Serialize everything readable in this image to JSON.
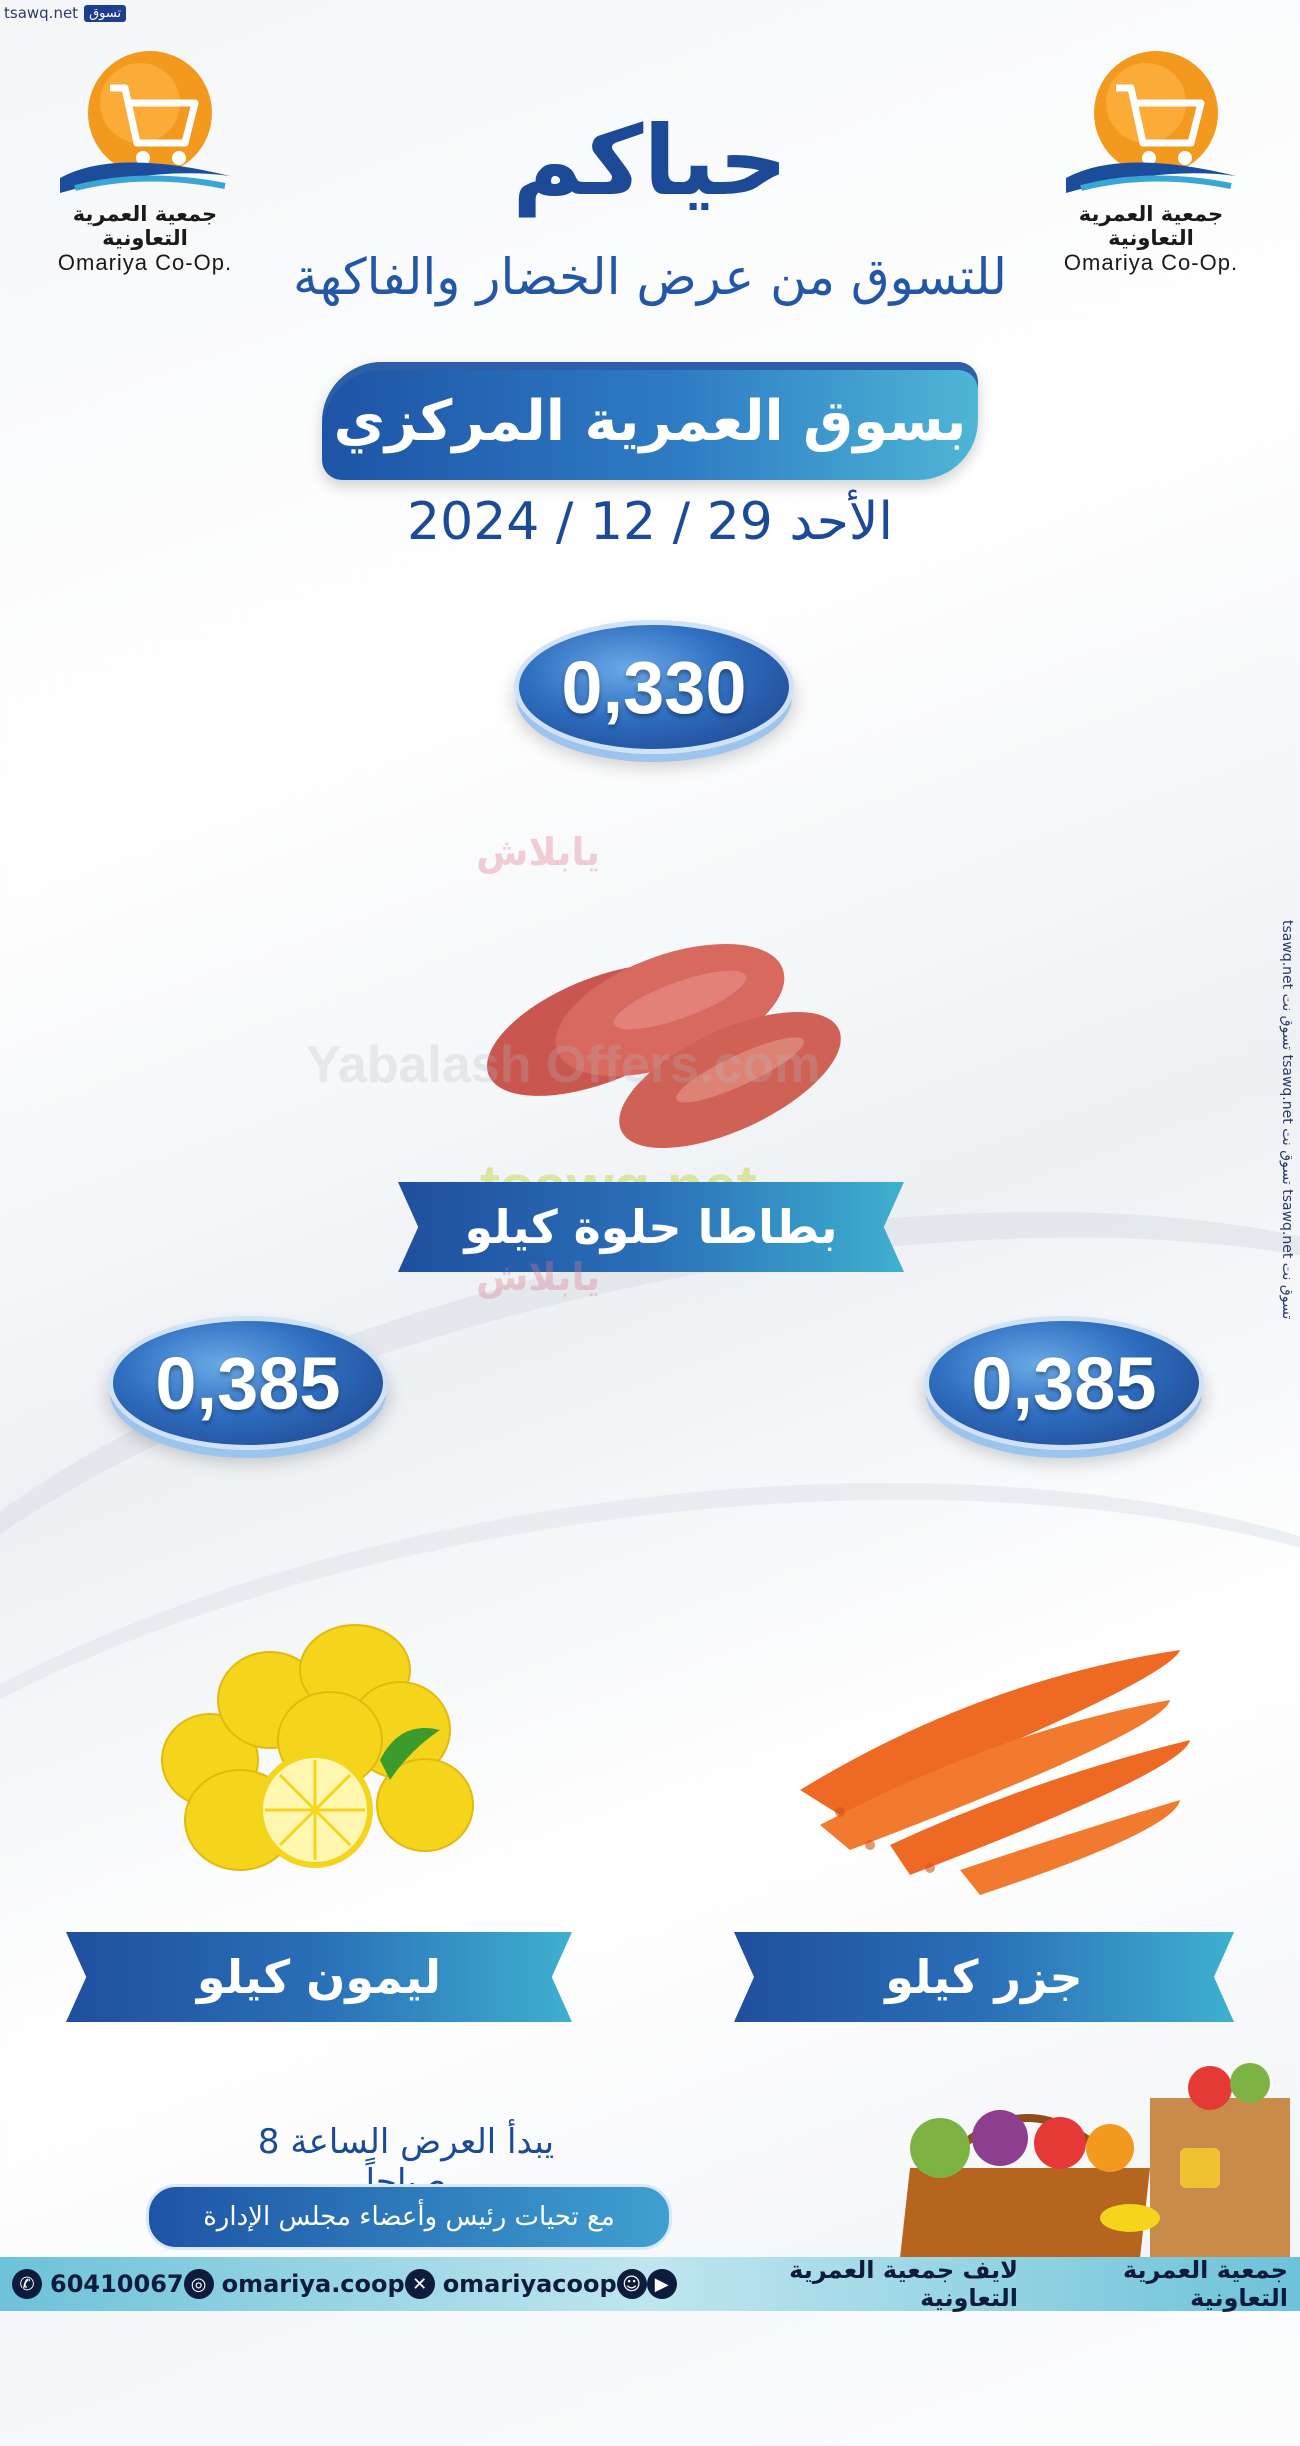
{
  "watermark_top": {
    "brand_ar": "تسوق",
    "domain": "tsawq.net"
  },
  "logo": {
    "name_ar": "جمعية العمرية التعاونية",
    "name_en": "Omariya Co-Op."
  },
  "header": {
    "greeting": "حياكم",
    "subtitle": "للتسوق من عرض الخضار والفاكهة",
    "location": "بسوق العمرية المركزي",
    "date": "الأحد 29 / 12 / 2024"
  },
  "watermarks": {
    "yabalash_ar": "يابلاش",
    "yabalash_en": "Yabalash Offers.com",
    "tsawq": "tsawq.net",
    "side": "tsawq.net تسوق نت tsawq.net تسوق نت tsawq.net تسوق نت"
  },
  "products": [
    {
      "name": "بطاطا حلوة كيلو",
      "price": "0,330"
    },
    {
      "name": "جزر كيلو",
      "price": "0,385"
    },
    {
      "name": "ليمون كيلو",
      "price": "0,385"
    }
  ],
  "footer": {
    "opening": "يبدأ العرض الساعة 8 صباحاً",
    "greeting": "مع تحيات رئيس وأعضاء مجلس الإدارة",
    "social": {
      "whatsapp": "60410067",
      "instagram": "omariya.coop",
      "x": "omariyacoop",
      "youtube": "لايف جمعية العمرية التعاونية",
      "coop": "جمعية العمرية التعاونية"
    }
  },
  "colors": {
    "primary": "#1d4a96",
    "accent": "#3fb0cf",
    "logo_orange": "#f39a1e"
  }
}
